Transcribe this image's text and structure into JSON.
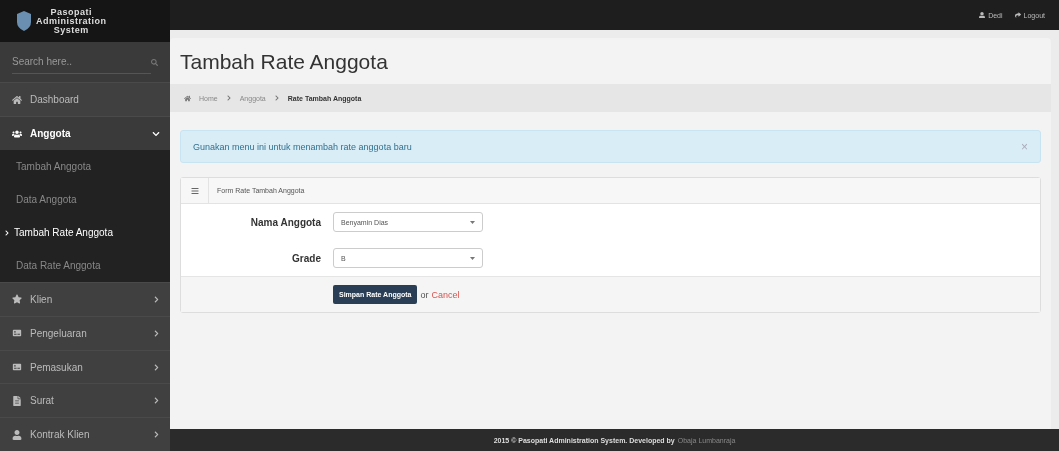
{
  "logo": {
    "line1": "Pasopati",
    "line2": "Administration",
    "line3": "System"
  },
  "search": {
    "placeholder": "Search here.."
  },
  "sidebar": {
    "items": [
      {
        "label": "Dashboard",
        "kind": "link",
        "expanded": false
      },
      {
        "label": "Anggota",
        "kind": "menu",
        "expanded": true,
        "children": [
          {
            "label": "Tambah Anggota",
            "selected": false
          },
          {
            "label": "Data Anggota",
            "selected": false
          },
          {
            "label": "Tambah Rate Anggota",
            "selected": true
          },
          {
            "label": "Data Rate Anggota",
            "selected": false
          }
        ]
      },
      {
        "label": "Klien",
        "kind": "menu",
        "expanded": false
      },
      {
        "label": "Pengeluaran",
        "kind": "menu",
        "expanded": false
      },
      {
        "label": "Pemasukan",
        "kind": "menu",
        "expanded": false
      },
      {
        "label": "Surat",
        "kind": "menu",
        "expanded": false
      },
      {
        "label": "Kontrak Klien",
        "kind": "menu",
        "expanded": false
      }
    ]
  },
  "topbar": {
    "user": "Dedi",
    "logout": "Logout"
  },
  "page_title": "Tambah Rate Anggota",
  "breadcrumb": [
    "Home",
    "Anggota",
    "Rate Tambah Anggota"
  ],
  "alert": {
    "text": "Gunakan menu ini untuk menambah rate anggota baru",
    "close": "×"
  },
  "form": {
    "title": "Form Rate Tambah Anggota",
    "fields": [
      {
        "label": "Nama Anggota",
        "value": "Benyamin Dias"
      },
      {
        "label": "Grade",
        "value": "B"
      }
    ],
    "submit": "Simpan Rate Anggota",
    "or": "or",
    "cancel": "Cancel"
  },
  "footer": {
    "text": "2015 © Pasopati Administration System. Developed by",
    "author": "Obaja Lumbanraja"
  }
}
